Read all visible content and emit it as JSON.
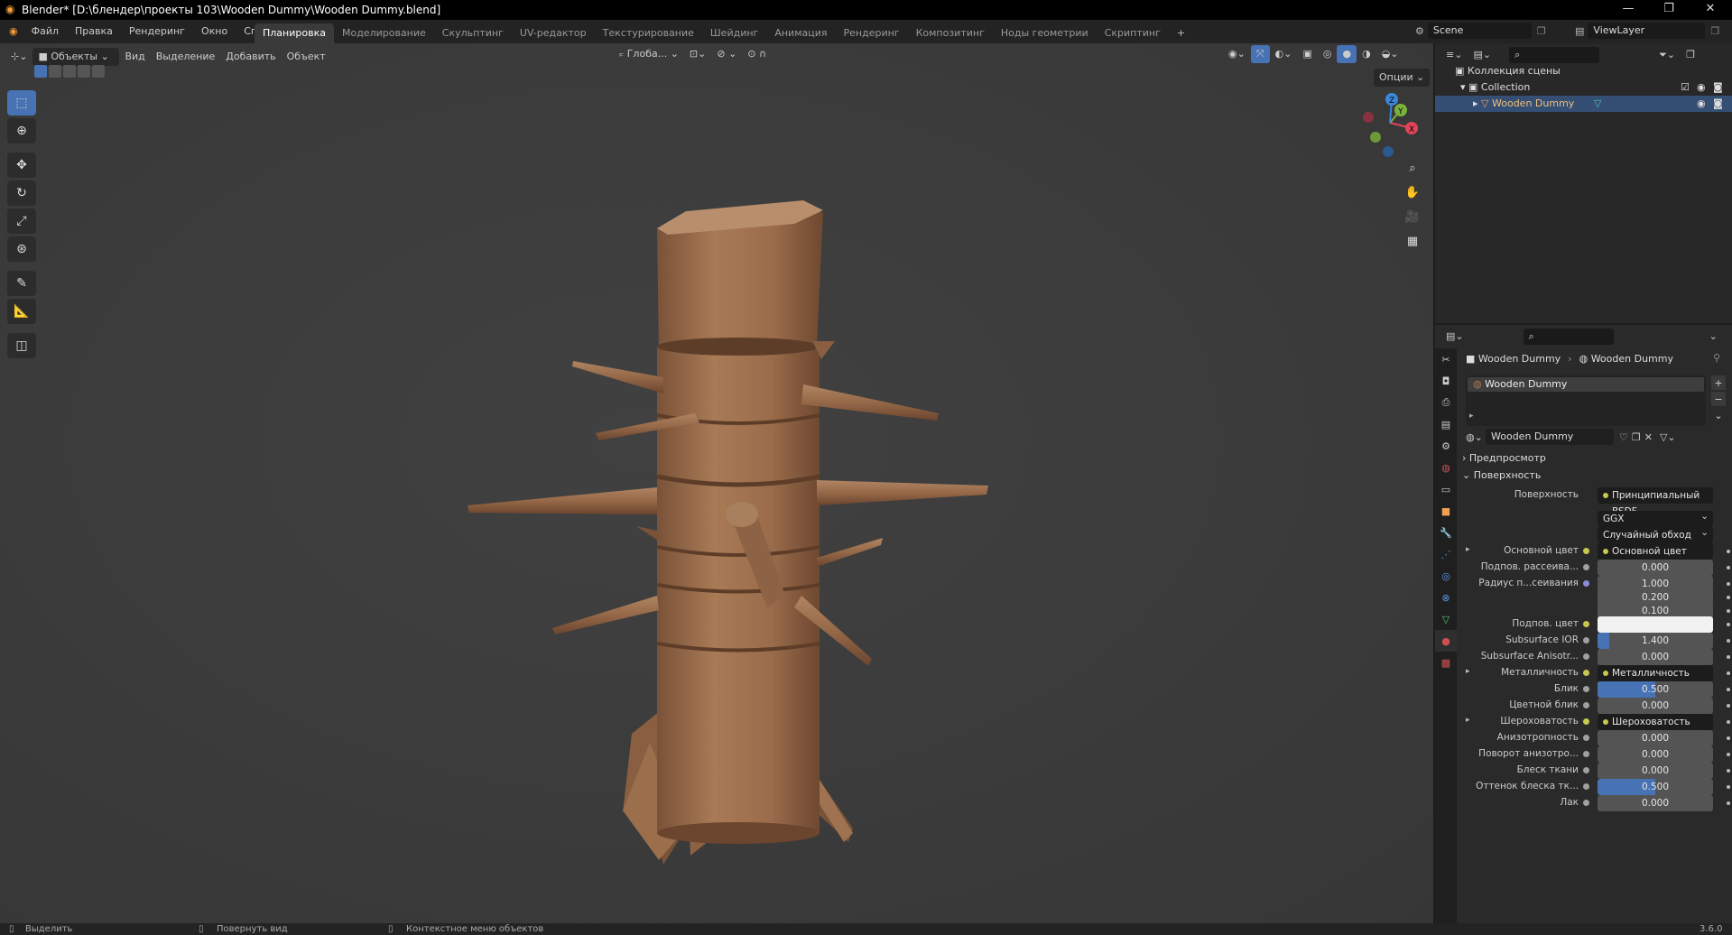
{
  "window": {
    "title": "Blender* [D:\\блендер\\проекты 103\\Wooden Dummy\\Wooden Dummy.blend]",
    "minimize": "—",
    "maximize": "❐",
    "close": "✕"
  },
  "menu": {
    "items": [
      "Файл",
      "Правка",
      "Рендеринг",
      "Окно",
      "Справка"
    ]
  },
  "workspaces": {
    "tabs": [
      "Планировка",
      "Моделирование",
      "Скульптинг",
      "UV-редактор",
      "Текстурирование",
      "Шейдинг",
      "Анимация",
      "Рендеринг",
      "Композитинг",
      "Ноды геометрии",
      "Скриптинг"
    ],
    "active": "Планировка",
    "add": "+"
  },
  "scene": {
    "name": "Scene",
    "viewlayer": "ViewLayer"
  },
  "viewport_header": {
    "mode": "Объекты",
    "menus": [
      "Вид",
      "Выделение",
      "Добавить",
      "Объект"
    ],
    "orientation": "Глоба...",
    "options": "Опции"
  },
  "gizmo": {
    "x": "X",
    "y": "Y",
    "z": "Z"
  },
  "outliner": {
    "scene_collection": "Коллекция сцены",
    "collection": "Collection",
    "object": "Wooden Dummy"
  },
  "properties": {
    "breadcrumb_object": "Wooden Dummy",
    "breadcrumb_material": "Wooden Dummy",
    "slot_name": "Wooden Dummy",
    "material_name": "Wooden Dummy",
    "panel_preview": "Предпросмотр",
    "panel_surface": "Поверхность",
    "surface_label": "Поверхность",
    "surface_value": "Принципиальный BSDF",
    "distribution": "GGX",
    "subsurface_method": "Случайный обход",
    "rows": [
      {
        "label": "Основной цвет",
        "type": "socket",
        "value": "Основной цвет",
        "expand": true
      },
      {
        "label": "Подпов. рассеива...",
        "type": "num",
        "value": "0.000",
        "fill": 0
      },
      {
        "label": "Радиус п...сеивания",
        "type": "num",
        "value": "1.000",
        "fill": 0,
        "purple": true
      },
      {
        "label": "",
        "type": "num",
        "value": "0.200",
        "fill": 0
      },
      {
        "label": "",
        "type": "num",
        "value": "0.100",
        "fill": 0
      },
      {
        "label": "Подпов. цвет",
        "type": "color",
        "value": "",
        "fill": 0
      },
      {
        "label": "Subsurface IOR",
        "type": "num",
        "value": "1.400",
        "fill": 0.1
      },
      {
        "label": "Subsurface Anisotr...",
        "type": "num",
        "value": "0.000",
        "fill": 0
      },
      {
        "label": "Металличность",
        "type": "socket",
        "value": "Металличность",
        "expand": true
      },
      {
        "label": "Блик",
        "type": "num",
        "value": "0.500",
        "fill": 0.5
      },
      {
        "label": "Цветной блик",
        "type": "num",
        "value": "0.000",
        "fill": 0
      },
      {
        "label": "Шероховатость",
        "type": "socket",
        "value": "Шероховатость",
        "expand": true
      },
      {
        "label": "Анизотропность",
        "type": "num",
        "value": "0.000",
        "fill": 0
      },
      {
        "label": "Поворот анизотро...",
        "type": "num",
        "value": "0.000",
        "fill": 0
      },
      {
        "label": "Блеск ткани",
        "type": "num",
        "value": "0.000",
        "fill": 0
      },
      {
        "label": "Оттенок блеска тк...",
        "type": "num",
        "value": "0.500",
        "fill": 0.5
      },
      {
        "label": "Лак",
        "type": "num",
        "value": "0.000",
        "fill": 0
      }
    ]
  },
  "statusbar": {
    "select": "Выделить",
    "rotate": "Повернуть вид",
    "context": "Контекстное меню объектов",
    "version": "3.6.0"
  },
  "colors": {
    "accent": "#4772b3",
    "viewport_bg": "#3b3b3b",
    "wood": "#9a6b4a"
  }
}
